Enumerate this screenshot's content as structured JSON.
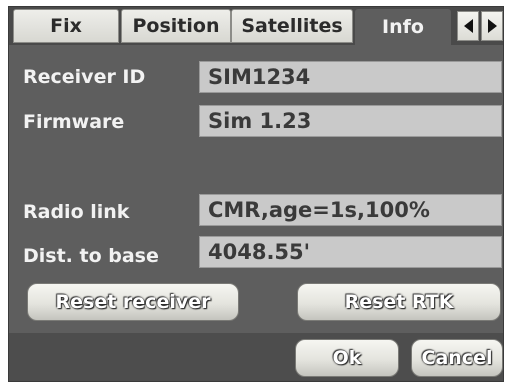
{
  "tabs": [
    {
      "label": "Fix"
    },
    {
      "label": "Position"
    },
    {
      "label": "Satellites"
    },
    {
      "label": "Info",
      "active": true
    }
  ],
  "rows": {
    "receiver_id": {
      "label": "Receiver ID",
      "value": "SIM1234"
    },
    "firmware": {
      "label": "Firmware",
      "value": "Sim 1.23"
    },
    "radio_link": {
      "label": "Radio link",
      "value": "CMR,age=1s,100%"
    },
    "dist_to_base": {
      "label": "Dist. to base",
      "value": "4048.55'"
    }
  },
  "buttons": {
    "reset_receiver": "Reset receiver",
    "reset_rtk": "Reset RTK",
    "ok": "Ok",
    "cancel": "Cancel"
  },
  "icons": {
    "scroll_left": "triangle-left-icon",
    "scroll_right": "triangle-right-icon"
  },
  "colors": {
    "panel_bg": "#5e5e5e",
    "field_bg": "#c9c9c9",
    "label_text": "#f2f2f2"
  }
}
